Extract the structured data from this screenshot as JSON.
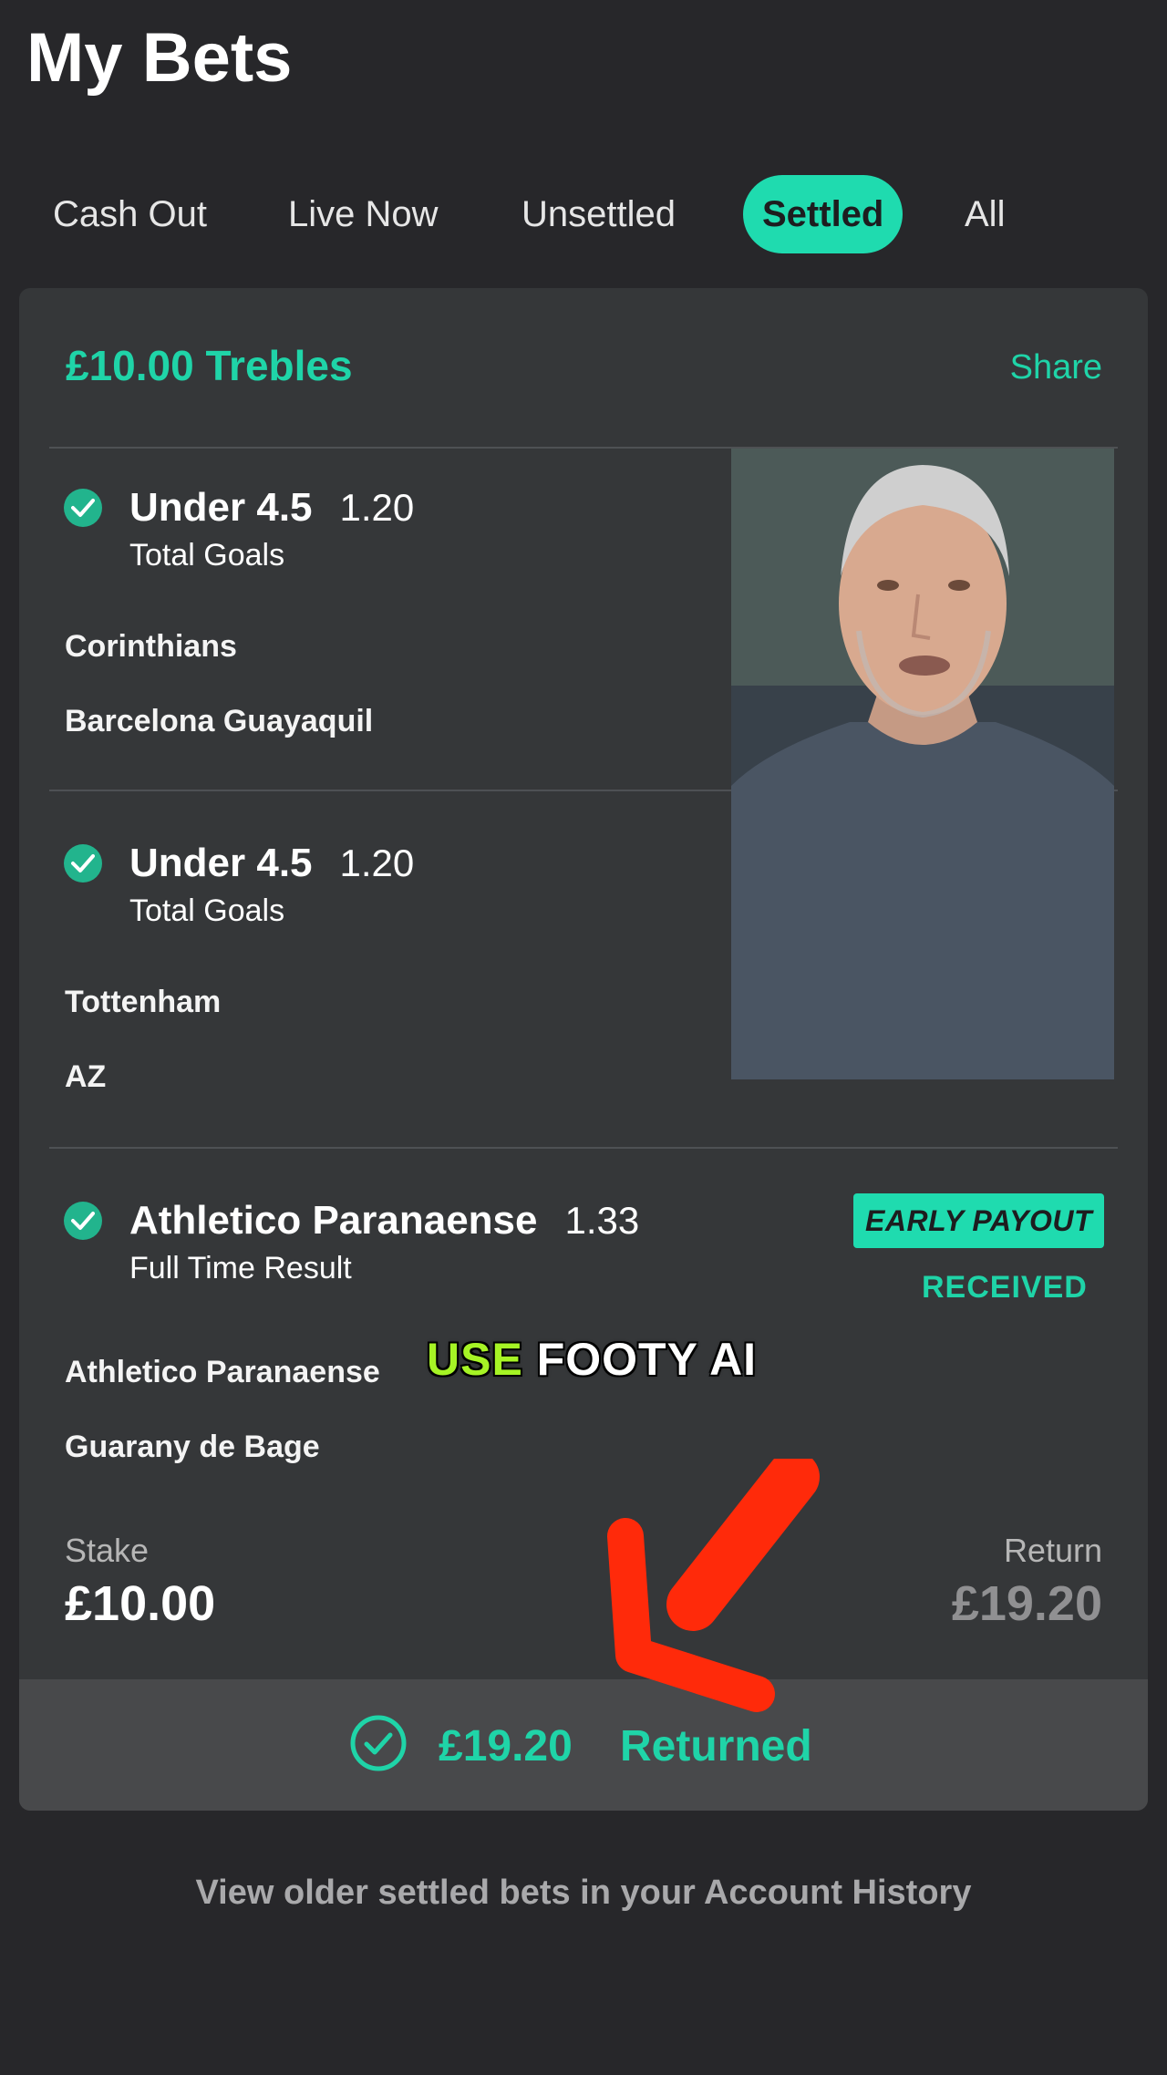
{
  "header": {
    "title": "My Bets"
  },
  "tabs": [
    {
      "label": "Cash Out",
      "active": false
    },
    {
      "label": "Live Now",
      "active": false
    },
    {
      "label": "Unsettled",
      "active": false
    },
    {
      "label": "Settled",
      "active": true
    },
    {
      "label": "All",
      "active": false
    }
  ],
  "bet": {
    "title": "£10.00 Trebles",
    "share_label": "Share",
    "selections": [
      {
        "name": "Under 4.5",
        "odds": "1.20",
        "market": "Total Goals",
        "teams": [
          "Corinthians",
          "Barcelona Guayaquil"
        ]
      },
      {
        "name": "Under 4.5",
        "odds": "1.20",
        "market": "Total Goals",
        "teams": [
          "Tottenham",
          "AZ"
        ]
      },
      {
        "name": "Athletico Paranaense",
        "odds": "1.33",
        "market": "Full Time Result",
        "teams": [
          "Athletico Paranaense",
          "Guarany de Bage"
        ],
        "badge": "EARLY PAYOUT",
        "badge_status": "RECEIVED"
      }
    ],
    "stake_label": "Stake",
    "stake_value": "£10.00",
    "return_label": "Return",
    "return_value": "£19.20",
    "returned_amount": "£19.20",
    "returned_label": "Returned"
  },
  "footer": {
    "history_text": "View older settled bets in your Account History"
  },
  "overlay": {
    "caption_word_1": "USE",
    "caption_word_2": "FOOTY AI"
  },
  "colors": {
    "accent": "#1fdbaf",
    "background": "#27272a",
    "card": "#353739",
    "arrow": "#ff2a0a",
    "caption_highlight": "#a6f425"
  }
}
